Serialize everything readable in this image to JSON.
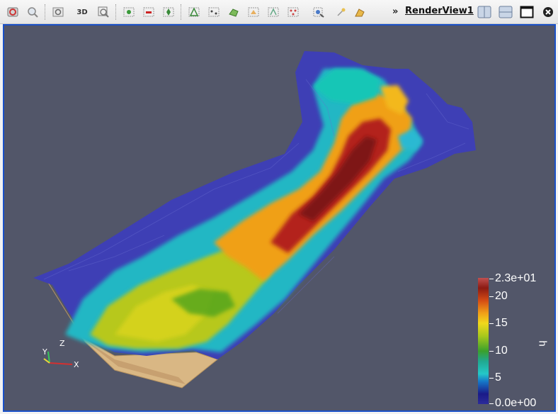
{
  "toolbar": {
    "buttons": [
      {
        "name": "reset-camera-icon"
      },
      {
        "name": "zoom-to-data-icon"
      },
      {
        "name": "capture-screenshot-icon"
      },
      {
        "name": "toggle-3d-button",
        "label": "3D"
      },
      {
        "name": "zoom-to-box-icon"
      },
      {
        "name": "select-cells-on-icon"
      },
      {
        "name": "select-points-on-icon"
      },
      {
        "name": "select-cells-through-icon"
      },
      {
        "name": "select-points-through-icon"
      },
      {
        "name": "select-polygon-cells-icon"
      },
      {
        "name": "select-polygon-points-icon"
      },
      {
        "name": "interactive-select-cells-icon"
      },
      {
        "name": "interactive-select-points-icon"
      },
      {
        "name": "hover-points-icon"
      },
      {
        "name": "hover-cells-icon"
      },
      {
        "name": "grow-selection-icon"
      },
      {
        "name": "clear-selection-icon"
      }
    ],
    "overflow": "»",
    "view_title": "RenderView1"
  },
  "colorbar": {
    "title": "h",
    "labels": {
      "max": "2.3e+01",
      "t20": "20",
      "t15": "15",
      "t10": "10",
      "t5": "5",
      "min": "0.0e+00"
    },
    "range": [
      0,
      23
    ]
  },
  "axes": {
    "x": "X",
    "y": "Y",
    "z": "Z"
  },
  "colors": {
    "background": "#525669",
    "border": "#1a50c8",
    "low": "#3b3fb2",
    "high": "#9a1a14"
  }
}
